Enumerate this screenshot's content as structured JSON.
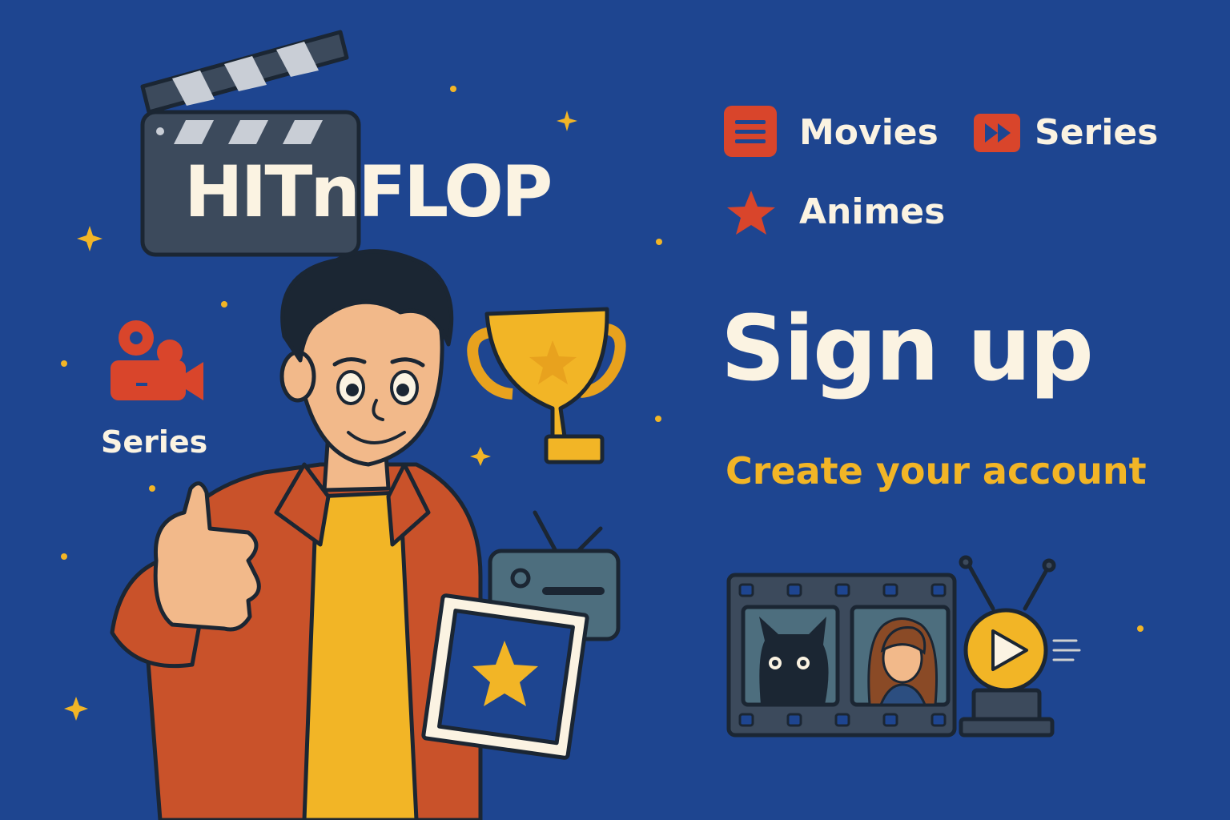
{
  "brand": {
    "name": "HITnFLOP"
  },
  "nav": {
    "movies_label": "Movies",
    "series_label": "Series",
    "animes_label": "Animes"
  },
  "side_badge": {
    "label": "Series"
  },
  "signup": {
    "title": "Sign up",
    "subtitle": "Create your account"
  },
  "colors": {
    "background": "#1e4590",
    "accent_red": "#d9452b",
    "accent_yellow": "#f2b526",
    "text_light": "#fbf3e2",
    "dark": "#2c3e50"
  },
  "icons": {
    "movies": "list-icon",
    "series": "fast-forward-icon",
    "animes": "star-icon",
    "side": "video-camera-icon"
  }
}
